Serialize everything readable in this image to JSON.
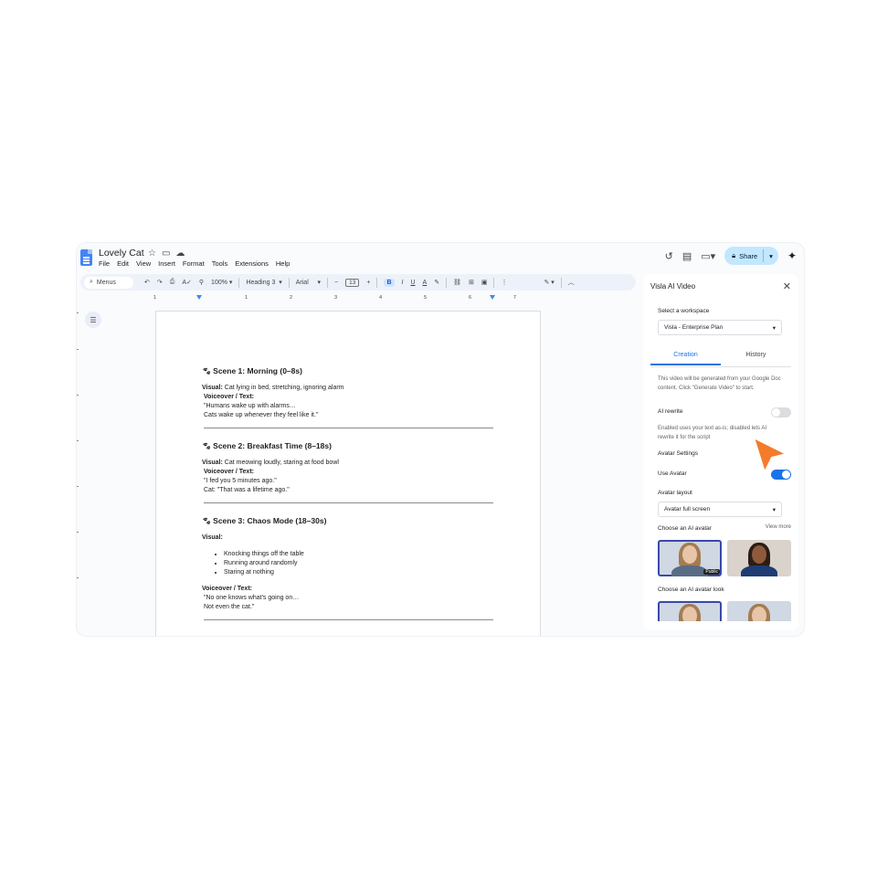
{
  "doc": {
    "title": "Lovely Cat",
    "menu": [
      "File",
      "Edit",
      "View",
      "Insert",
      "Format",
      "Tools",
      "Extensions",
      "Help"
    ]
  },
  "header": {
    "share_label": "Share"
  },
  "toolbar": {
    "search_label": "Menus",
    "zoom": "100%",
    "style": "Heading 3",
    "font": "Arial",
    "font_size": "13"
  },
  "ruler": [
    "1",
    "1",
    "2",
    "3",
    "4",
    "5",
    "6",
    "7"
  ],
  "content": {
    "scene1": {
      "heading": "Scene 1: Morning (0–8s)",
      "visual_label": "Visual:",
      "visual_text": " Cat lying in bed, stretching, ignoring alarm",
      "vo_label": "Voiceover / Text:",
      "line1": "\"Humans wake up with alarms…",
      "line2": "Cats wake up whenever they feel like it.\""
    },
    "scene2": {
      "heading": "Scene 2: Breakfast Time (8–18s)",
      "visual_label": "Visual:",
      "visual_text": " Cat meowing loudly, staring at food bowl",
      "vo_label": "Voiceover / Text:",
      "line1": "\"I fed you 5 minutes ago.\"",
      "line2": "Cat: \"That was a lifetime ago.\""
    },
    "scene3": {
      "heading": "Scene 3: Chaos Mode (18–30s)",
      "visual_label": "Visual:",
      "bullets": [
        "Knocking things off the table",
        "Running around randomly",
        "Staring at nothing"
      ],
      "vo_label": "Voiceover / Text:",
      "line1": "\"No one knows what's going on…",
      "line2": "Not even the cat.\""
    }
  },
  "panel": {
    "title": "Visla AI Video",
    "workspace_label": "Select a workspace",
    "workspace_value": "Visla - Enterprise Plan",
    "tabs": [
      "Creation",
      "History"
    ],
    "description": "This video will be generated from your Google Doc content. Click \"Generate Video\" to start.",
    "ai_rewrite_label": "AI rewrite",
    "ai_rewrite_on": false,
    "ai_rewrite_help": "Enabled uses your text as-is; disabled lets AI rewrite it for the script",
    "avatar_settings_label": "Avatar Settings",
    "use_avatar_label": "Use Avatar",
    "use_avatar_on": true,
    "layout_label": "Avatar layout",
    "layout_value": "Avatar full screen",
    "choose_avatar_label": "Choose an AI avatar",
    "view_more": "View more",
    "public_badge": "Public",
    "choose_look_label": "Choose an AI avatar look"
  },
  "colors": {
    "accent": "#1a73e8",
    "share_bg": "#c2e7ff",
    "cursor": "#f47b2a"
  }
}
